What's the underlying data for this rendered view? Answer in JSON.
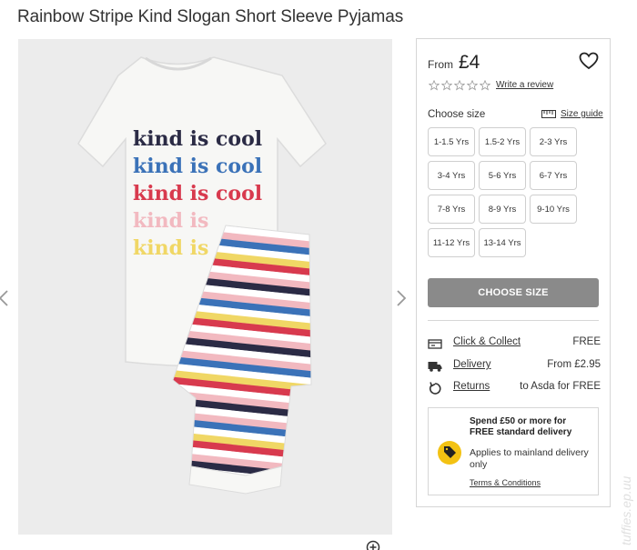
{
  "product": {
    "title": "Rainbow Stripe Kind Slogan Short Sleeve Pyjamas",
    "image_alt": "kind is cool",
    "slogan_lines": [
      "kind is cool",
      "kind is cool",
      "kind is cool",
      "kind is",
      "kind is"
    ],
    "slogan_colors": [
      "#2b2b45",
      "#3b72b8",
      "#d83a4e",
      "#f2b9c0",
      "#f0d765"
    ],
    "stripe_colors": [
      "#2b2b45",
      "#ffffff",
      "#f2b9c0",
      "#3b72b8",
      "#ffffff",
      "#f0d765",
      "#d83a4e",
      "#ffffff",
      "#f2b9c0"
    ]
  },
  "gallery": {
    "prev_icon": "chevron-left-icon",
    "next_icon": "chevron-right-icon",
    "zoom_icon": "zoom-in-icon"
  },
  "buy": {
    "from_label": "From",
    "price": "£4",
    "wishlist_icon": "heart-icon",
    "rating_icon": "star-outline-icon",
    "write_review": "Write a review",
    "choose_size_label": "Choose size",
    "size_guide": "Size guide",
    "sizes": [
      "1-1.5 Yrs",
      "1.5-2 Yrs",
      "2-3 Yrs",
      "3-4 Yrs",
      "5-6 Yrs",
      "6-7 Yrs",
      "7-8 Yrs",
      "8-9 Yrs",
      "9-10 Yrs",
      "11-12 Yrs",
      "13-14 Yrs"
    ],
    "choose_size_button": "CHOOSE SIZE"
  },
  "fulfilment": [
    {
      "icon": "store-icon",
      "label": "Click & Collect",
      "value": "FREE"
    },
    {
      "icon": "truck-icon",
      "label": "Delivery",
      "value": "From £2.95"
    },
    {
      "icon": "return-icon",
      "label": "Returns",
      "value": "to Asda for FREE"
    }
  ],
  "promo": {
    "headline": "Spend £50 or more for FREE standard delivery",
    "icon": "tag-icon",
    "body": "Applies to mainland delivery only",
    "terms": "Terms & Conditions"
  },
  "watermark": "tuffies.ep.uu",
  "colors": {
    "button_grey": "#8a8a8a",
    "promo_yellow": "#f3c213",
    "border": "#d6d6d6"
  }
}
